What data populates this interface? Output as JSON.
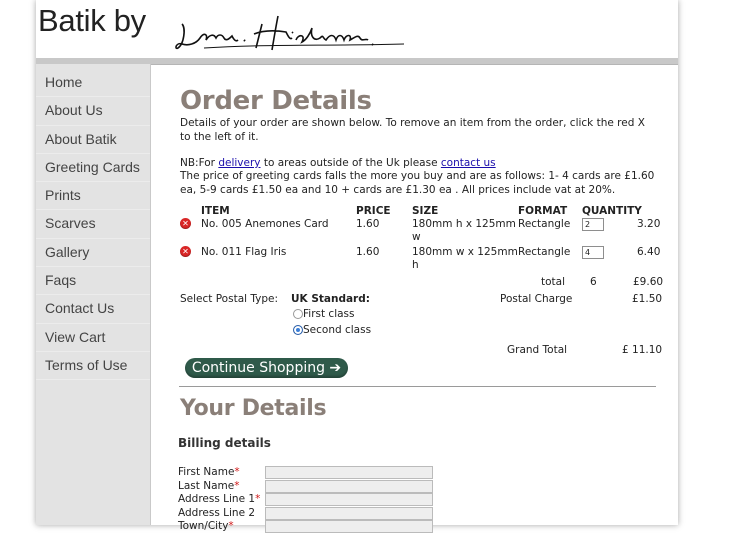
{
  "header": {
    "brand": "Batik by",
    "signature_text": "Jane Hickman"
  },
  "sidebar": {
    "items": [
      {
        "label": "Home"
      },
      {
        "label": "About Us"
      },
      {
        "label": "About Batik"
      },
      {
        "label": "Greeting Cards"
      },
      {
        "label": "Prints"
      },
      {
        "label": "Scarves"
      },
      {
        "label": "Gallery"
      },
      {
        "label": "Faqs"
      },
      {
        "label": "Contact Us"
      },
      {
        "label": "View Cart"
      },
      {
        "label": "Terms of Use"
      }
    ]
  },
  "order": {
    "title": "Order Details",
    "intro": "Details of your order are shown below. To remove an item from the order, click the red X to the left of it.",
    "nb_prefix": "NB:For ",
    "nb_link1": "delivery",
    "nb_middle": " to areas outside of the Uk please ",
    "nb_link2": "contact us",
    "pricing_note": "The price of greeting cards falls the more you buy and are as follows: 1- 4 cards are £1.60 ea, 5-9 cards £1.50 ea and 10 + cards are £1.30 ea . All prices include vat at 20%.",
    "columns": {
      "item": "ITEM",
      "price": "PRICE",
      "size": "SIZE",
      "format": "FORMAT",
      "quantity": "QUANTITY"
    },
    "remove_icon": "x-circle-icon",
    "rows": [
      {
        "item": "No. 005 Anemones Card",
        "price": "1.60",
        "size_line1": "180mm h x 125mm",
        "size_line2": "w",
        "format": "Rectangle",
        "quantity": "2",
        "total": "3.20"
      },
      {
        "item": "No. 011 Flag Iris",
        "price": "1.60",
        "size_line1": "180mm w x 125mm",
        "size_line2": "h",
        "format": "Rectangle",
        "quantity": "4",
        "total": "6.40"
      }
    ],
    "total_label": "total",
    "total_qty": "6",
    "total_amount": "£9.60",
    "postal_type_label": "Select Postal Type:",
    "postal_group": "UK Standard:",
    "postal_options": [
      {
        "label": "First class",
        "selected": false
      },
      {
        "label": "Second class",
        "selected": true
      }
    ],
    "postal_charge_label": "Postal Charge",
    "postal_charge": "£1.50",
    "grand_total_label": "Grand Total",
    "grand_total": "£ 11.10",
    "continue_label": "Continue Shopping ➔"
  },
  "details": {
    "title": "Your Details",
    "billing_heading": "Billing details",
    "fields": [
      {
        "label": "First Name",
        "required": "*"
      },
      {
        "label": "Last Name",
        "required": "*"
      },
      {
        "label": "Address Line 1",
        "required": "*"
      },
      {
        "label": "Address Line 2",
        "required": ""
      },
      {
        "label": "Town/City",
        "required": "*"
      }
    ]
  },
  "colors": {
    "accent_button": "#2f5a4a",
    "heading": "#8a7f78",
    "remove_icon": "#d92626",
    "required_mark": "#d01818",
    "sidebar_bg": "#e3e3e3"
  }
}
